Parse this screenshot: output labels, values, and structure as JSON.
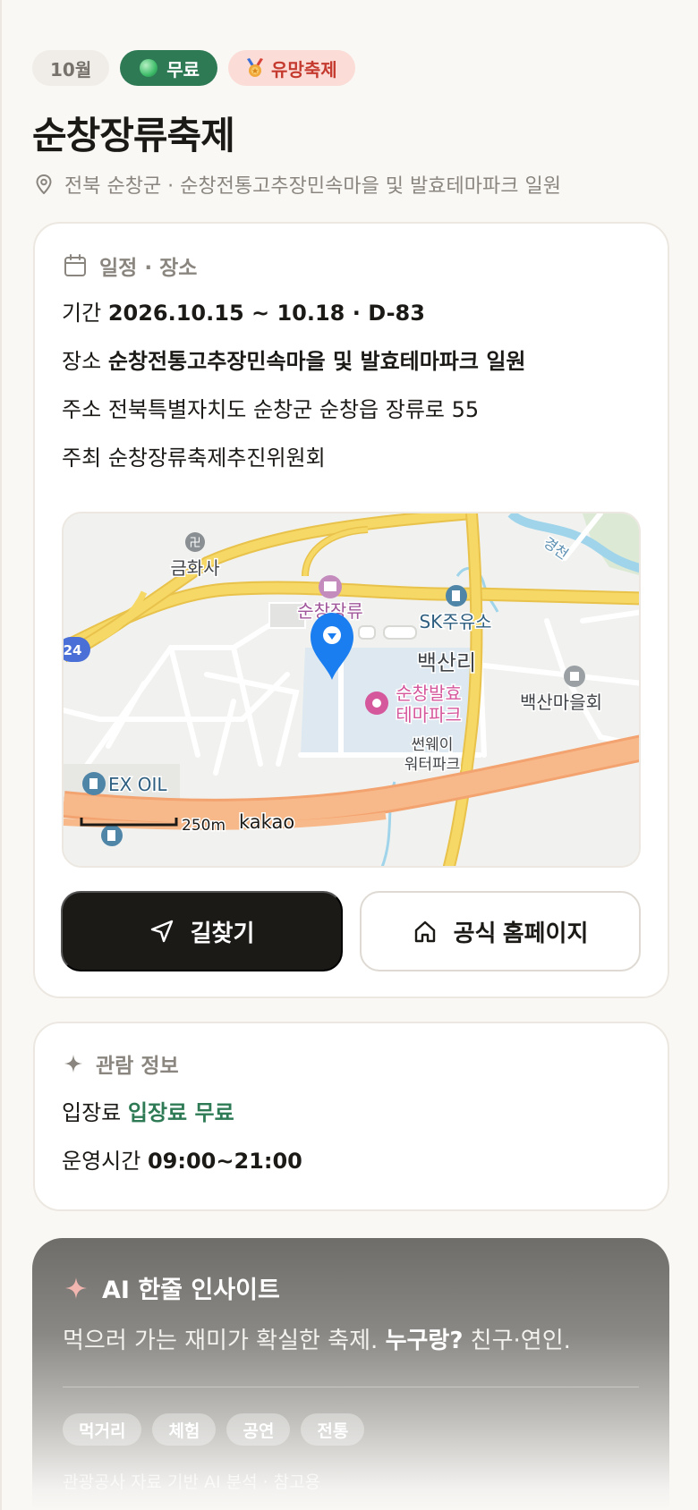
{
  "badges": {
    "month": "10월",
    "free": "무료",
    "promising": "유망축제"
  },
  "festival": {
    "title": "순창장류축제",
    "location": "전북 순창군 · 순창전통고추장민속마을 및 발효테마파크 일원"
  },
  "schedule_card": {
    "heading": "일정 · 장소",
    "period_label": "기간",
    "period_value": "2026.10.15 ~ 10.18 · D-83",
    "place_label": "장소",
    "place_value": "순창전통고추장민속마을 및 발효테마파크 일원",
    "address_label": "주소",
    "address_value": "전북특별자치도 순창군 순창읍 장류로 55",
    "host_label": "주최",
    "host_value": "순창장류축제추진위원회"
  },
  "map": {
    "labels": {
      "temple": "금화사",
      "museum": "순창장류",
      "gas_station_sk": "SK주유소",
      "village": "백산리",
      "theme_park_1": "순창발효",
      "theme_park_2": "테마파크",
      "waterpark_1": "썬웨이",
      "waterpark_2": "워터파크",
      "village_hall": "백산마을회",
      "gas_station_ex": "EX OIL",
      "stream": "경천",
      "route": "24",
      "scale": "250m",
      "brand": "kakao"
    },
    "colors": {
      "road_major": "#f6d866",
      "highway": "#f8b98a",
      "water": "#8fd0ea",
      "park": "#dde8f1",
      "marker": "#1a7ef0"
    }
  },
  "actions": {
    "directions": "길찾기",
    "homepage": "공식 홈페이지"
  },
  "visit_card": {
    "heading": "관람 정보",
    "fee_label": "입장료",
    "fee_value": "입장료 무료",
    "hours_label": "운영시간",
    "hours_value": "09:00~21:00"
  },
  "ai_insight": {
    "heading": "AI 한줄 인사이트",
    "text_lead": "먹으러 가는 재미가 확실한 축제.",
    "text_bold": "누구랑?",
    "text_tail": "친구·연인.",
    "tags": [
      "먹거리",
      "체험",
      "공연",
      "전통"
    ],
    "footnote": "관광공사 자료 기반 AI 분석 · 참고용"
  },
  "colors": {
    "accent_green": "#2d7a55",
    "accent_red": "#c53a2f",
    "dark": "#1c1a17"
  }
}
